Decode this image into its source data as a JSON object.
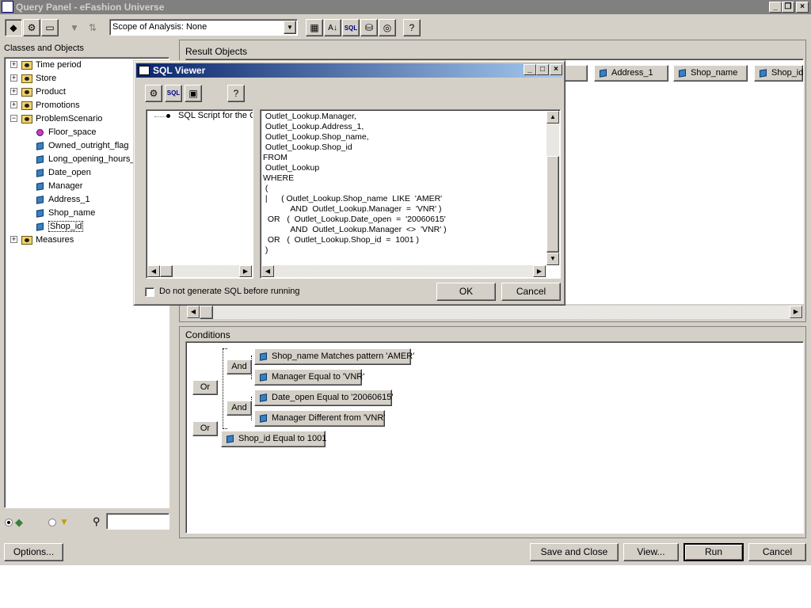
{
  "window": {
    "title": "Query Panel - eFashion Universe"
  },
  "toolbar": {
    "scope_label": "Scope of Analysis: None",
    "sql_text": "SQL"
  },
  "left_panel": {
    "header": "Classes and Objects",
    "tree": [
      {
        "label": "Time period",
        "type": "class",
        "expanded": false
      },
      {
        "label": "Store",
        "type": "class",
        "expanded": false
      },
      {
        "label": "Product",
        "type": "class",
        "expanded": false
      },
      {
        "label": "Promotions",
        "type": "class",
        "expanded": false
      },
      {
        "label": "ProblemScenario",
        "type": "class",
        "expanded": true
      },
      {
        "label": "Floor_space",
        "type": "measure"
      },
      {
        "label": "Owned_outright_flag",
        "type": "dimension"
      },
      {
        "label": "Long_opening_hours_",
        "type": "dimension"
      },
      {
        "label": "Date_open",
        "type": "dimension"
      },
      {
        "label": "Manager",
        "type": "dimension"
      },
      {
        "label": "Address_1",
        "type": "dimension"
      },
      {
        "label": "Shop_name",
        "type": "dimension"
      },
      {
        "label": "Shop_id",
        "type": "dimension",
        "selected": true
      },
      {
        "label": "Measures",
        "type": "class",
        "expanded": false
      }
    ],
    "search_value": ""
  },
  "result_objects": {
    "header": "Result Objects",
    "chips": [
      "Address_1",
      "Shop_name",
      "Shop_id"
    ]
  },
  "conditions": {
    "header": "Conditions",
    "operators": {
      "or1": "Or",
      "or2": "Or",
      "and1": "And",
      "and2": "And"
    },
    "items": [
      "Shop_name Matches pattern 'AMER'",
      "Manager Equal to 'VNR'",
      "Date_open Equal to '20060615'",
      "Manager Different from 'VNR'",
      "Shop_id Equal to 1001"
    ]
  },
  "sql_viewer": {
    "title": "SQL Viewer",
    "sql_toolbar_text": "SQL",
    "tree_item": "SQL Script for the Q",
    "sql_lines": [
      " Outlet_Lookup.Manager,",
      " Outlet_Lookup.Address_1,",
      " Outlet_Lookup.Shop_name,",
      " Outlet_Lookup.Shop_id",
      "FROM",
      " Outlet_Lookup",
      "WHERE",
      " (",
      " |      ( Outlet_Lookup.Shop_name  LIKE  'AMER'",
      "            AND  Outlet_Lookup.Manager  =  'VNR' )",
      "  OR   (  Outlet_Lookup.Date_open  =  '20060615'",
      "            AND  Outlet_Lookup.Manager  <>  'VNR' )",
      "  OR   (  Outlet_Lookup.Shop_id  =  1001 )",
      " )"
    ],
    "checkbox_label": "Do not generate SQL before running",
    "checkbox_checked": false,
    "ok_label": "OK",
    "cancel_label": "Cancel"
  },
  "bottom_buttons": {
    "options": "Options...",
    "save_close": "Save and Close",
    "view": "View...",
    "run": "Run",
    "cancel": "Cancel"
  }
}
